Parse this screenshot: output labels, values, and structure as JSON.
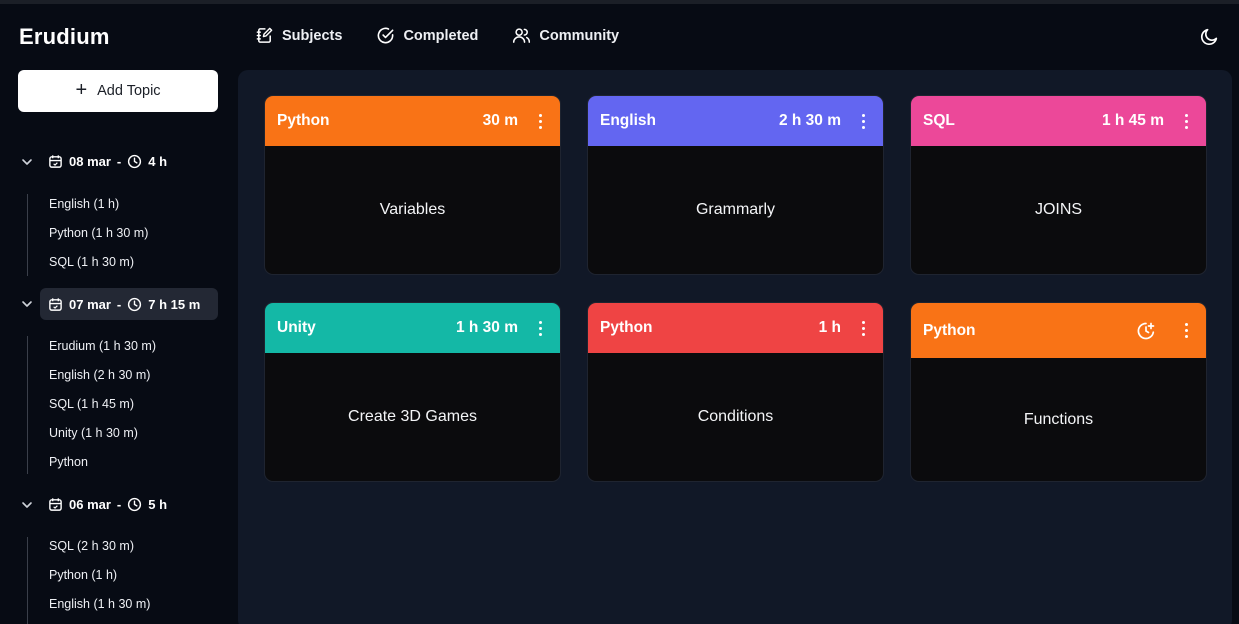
{
  "app": {
    "title": "Erudium"
  },
  "sidebar": {
    "add_label": "Add Topic",
    "groups": [
      {
        "date": "08 mar",
        "total": "4 h",
        "active": false,
        "items": [
          "English (1 h)",
          "Python (1 h 30 m)",
          "SQL (1 h 30 m)"
        ]
      },
      {
        "date": "07 mar",
        "total": "7 h 15 m",
        "active": true,
        "items": [
          "Erudium (1 h 30 m)",
          "English (2 h 30 m)",
          "SQL (1 h 45 m)",
          "Unity (1 h 30 m)",
          "Python"
        ]
      },
      {
        "date": "06 mar",
        "total": "5 h",
        "active": false,
        "items": [
          "SQL (2 h 30 m)",
          "Python (1 h)",
          "English (1 h 30 m)"
        ]
      }
    ],
    "separator": "-"
  },
  "nav": [
    {
      "label": "Subjects",
      "icon": "notebook-pen-icon"
    },
    {
      "label": "Completed",
      "icon": "check-circle-icon"
    },
    {
      "label": "Community",
      "icon": "users-icon"
    }
  ],
  "theme_toggle_icon": "moon-icon",
  "cards": [
    {
      "subject": "Python",
      "duration": "30 m",
      "topic": "Variables",
      "color": "#f97316"
    },
    {
      "subject": "English",
      "duration": "2 h 30 m",
      "topic": "Grammarly",
      "color": "#6366f1"
    },
    {
      "subject": "SQL",
      "duration": "1 h 45 m",
      "topic": "JOINS",
      "color": "#ec4899"
    },
    {
      "subject": "Unity",
      "duration": "1 h 30 m",
      "topic": "Create 3D Games",
      "color": "#14b8a6"
    },
    {
      "subject": "Python",
      "duration": "1 h",
      "topic": "Conditions",
      "color": "#ef4444"
    },
    {
      "subject": "Python",
      "duration": "",
      "topic": "Functions",
      "color": "#f97316",
      "timer_icon": "clock-plus-icon"
    }
  ]
}
